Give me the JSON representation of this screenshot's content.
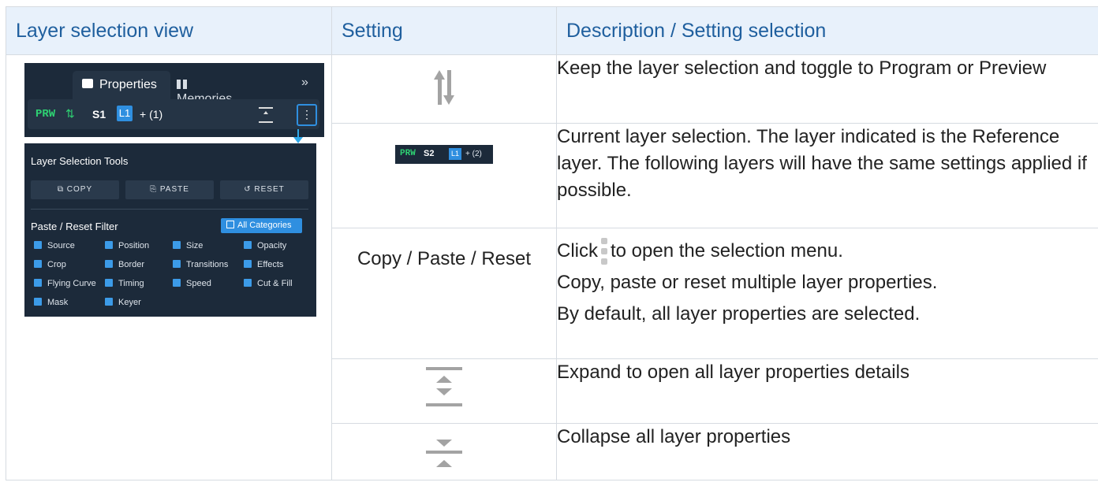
{
  "headers": {
    "col1": "Layer selection view",
    "col2": "Setting",
    "col3": "Description / Setting selection"
  },
  "screenshot": {
    "tab_properties": "Properties",
    "tab_memories": "Memories",
    "more_icon": "»",
    "prw_label": "PRW",
    "toggle_icon": "⇅",
    "source_label": "S1",
    "layer_label": "L1",
    "extra_layers": "+ (1)",
    "menu_icon": "⋮",
    "tools_title": "Layer Selection Tools",
    "copy_label": "COPY",
    "paste_label": "PASTE",
    "reset_label": "RESET",
    "filter_title": "Paste / Reset Filter",
    "all_categories": "All Categories",
    "filters": [
      "Source",
      "Position",
      "Size",
      "Opacity",
      "Crop",
      "Border",
      "Transitions",
      "Effects",
      "Flying Curve",
      "Timing",
      "Speed",
      "Cut & Fill",
      "Mask",
      "Keyer"
    ]
  },
  "badge": {
    "prw": "PRW",
    "source": "S2",
    "layer": "L1",
    "extra": "+ (2)"
  },
  "rows": {
    "toggle_desc": "Keep the layer selection and toggle to Program or Preview",
    "current_desc": "Current layer selection. The layer indicated is the Reference layer. The following layers will have the same settings applied if possible.",
    "copy_setting": "Copy / Paste / Reset",
    "copy_click_prefix": "Click",
    "copy_click_suffix": "to open the selection menu.",
    "copy_desc2": "Copy, paste or reset multiple layer properties.",
    "copy_desc3": "By default, all layer properties are selected.",
    "expand_desc": "Expand to open all layer properties details",
    "collapse_desc": "Collapse all layer properties"
  },
  "colors": {
    "header_bg": "#e8f1fb",
    "header_text": "#1f5f9e",
    "dark_panel": "#1c2a3a",
    "accent_blue": "#2f8fe0",
    "prw_green": "#2ed072",
    "icon_gray": "#a3a3a3"
  }
}
